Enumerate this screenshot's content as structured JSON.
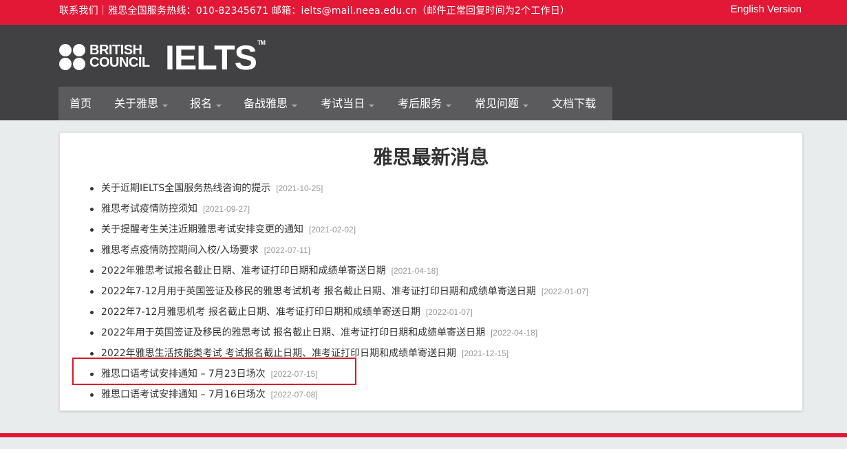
{
  "topbar": {
    "contact": "联系我们｜雅思全国服务热线：010-82345671   邮箱：ielts@mail.neea.edu.cn（邮件正常回复时间为2个工作日）",
    "english_version": "English Version",
    "color": "#e31837"
  },
  "header": {
    "bc_line1": "BRITISH",
    "bc_line2": "COUNCIL",
    "ielts": "IELTS",
    "tm": "TM"
  },
  "nav": {
    "items": [
      {
        "label": "首页"
      },
      {
        "label": "关于雅思"
      },
      {
        "label": "报名"
      },
      {
        "label": "备战雅思"
      },
      {
        "label": "考试当日"
      },
      {
        "label": "考后服务"
      },
      {
        "label": "常见问题"
      },
      {
        "label": "文档下载"
      }
    ]
  },
  "main": {
    "title": "雅思最新消息",
    "news": [
      {
        "title": "关于近期IELTS全国服务热线咨询的提示",
        "date": "[2021-10-25]"
      },
      {
        "title": "雅思考试疫情防控须知",
        "date": "[2021-09-27]"
      },
      {
        "title": "关于提醒考生关注近期雅思考试安排变更的通知",
        "date": "[2021-02-02]"
      },
      {
        "title": "雅思考点疫情防控期间入校/入场要求",
        "date": "[2022-07-11]"
      },
      {
        "title": "2022年雅思考试报名截止日期、准考证打印日期和成绩单寄送日期",
        "date": "[2021-04-18]"
      },
      {
        "title": "2022年7-12月用于英国签证及移民的雅思考试机考 报名截止日期、准考证打印日期和成绩单寄送日期",
        "date": "[2022-01-07]"
      },
      {
        "title": "2022年7-12月雅思机考 报名截止日期、准考证打印日期和成绩单寄送日期",
        "date": "[2022-01-07]"
      },
      {
        "title": "2022年用于英国签证及移民的雅思考试 报名截止日期、准考证打印日期和成绩单寄送日期",
        "date": "[2022-04-18]"
      },
      {
        "title": "2022年雅思生活技能类考试 考试报名截止日期、准考证打印日期和成绩单寄送日期",
        "date": "[2021-12-15]"
      },
      {
        "title": "雅思口语考试安排通知 – 7月23日场次",
        "date": "[2022-07-15]"
      },
      {
        "title": "雅思口语考试安排通知 – 7月16日场次",
        "date": "[2022-07-08]"
      }
    ]
  }
}
